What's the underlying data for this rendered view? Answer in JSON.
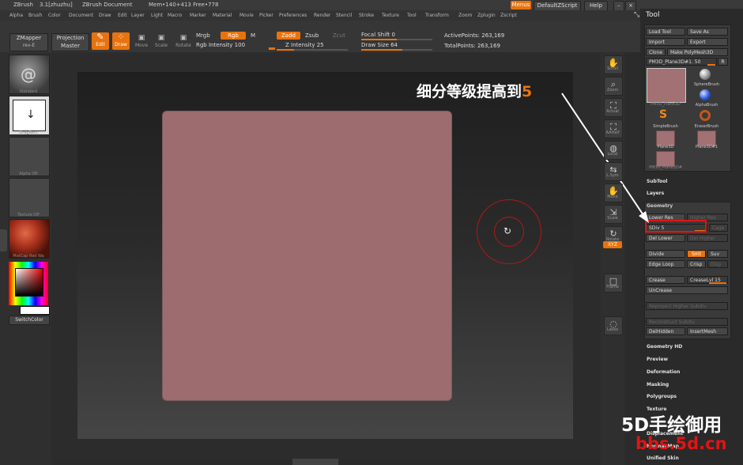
{
  "title_bar": {
    "app": "ZBrush",
    "version": "3.1[zhuzhu]",
    "document": "ZBrush Document",
    "mem": "Mem•140+413 Free•778",
    "menus_btn": "Menus",
    "script_btn": "DefaultZScript",
    "help_btn": "Help"
  },
  "menu_bar": [
    "Alpha",
    "Brush",
    "Color",
    "Document",
    "Draw",
    "Edit",
    "Layer",
    "Light",
    "Macro",
    "Marker",
    "Material",
    "Movie",
    "Picker",
    "Preferences",
    "Render",
    "Stencil",
    "Stroke",
    "Texture",
    "Tool",
    "Transform",
    "Zoom",
    "Zplugin",
    "Zscript"
  ],
  "toolbar": {
    "zmapper": "ZMapper",
    "zmapper_sub": "rev-E",
    "projection": "Projection",
    "master": "Master",
    "edit": "Edit",
    "draw": "Draw",
    "move": "Move",
    "scale": "Scale",
    "rotate": "Rotate",
    "mrgb": "Mrgb",
    "rgb": "Rgb",
    "m": "M",
    "rgb_intensity": "Rgb Intensity 100",
    "zadd": "Zadd",
    "zsub": "Zsub",
    "zcut": "Zcut",
    "z_intensity": "Z Intensity 25",
    "focal_shift": "Focal Shift 0",
    "draw_size": "Draw Size 64",
    "active_points": "ActivePoints: 263,169",
    "total_points": "TotalPoints: 263,169"
  },
  "left_shelf": {
    "brush": "Standard",
    "stroke": "DragRect",
    "alpha": "Alpha Off",
    "texture": "Texture Off",
    "material": "MatCap Red Wa",
    "switch_color": "SwitchColor"
  },
  "right_shelf": [
    "Scroll",
    "Zoom",
    "Actual",
    "AAHalf",
    "Local",
    "L.Sym",
    "Move",
    "Scale",
    "Rotate",
    "XYZ",
    "Frame",
    "Lasso"
  ],
  "tool_panel": {
    "title": "Tool",
    "load_tool": "Load Tool",
    "save_as": "Save As",
    "import": "Import",
    "export": "Export",
    "clone": "Clone",
    "make_polymesh": "Make PolyMesh3D",
    "current_tool": "PM3D_Plane3D#1. 50",
    "r_btn": "R",
    "tools": [
      {
        "label": "PM3D_Plane3D",
        "kind": "plane"
      },
      {
        "label": "SphereBrush",
        "kind": "sphere"
      },
      {
        "label": "AlphaBrush",
        "kind": "alpha"
      },
      {
        "label": "SimpleBrush",
        "kind": "simple"
      },
      {
        "label": "EraserBrush",
        "kind": "eraser"
      },
      {
        "label": "Plane3D",
        "kind": "plane"
      },
      {
        "label": "Plane3D#1",
        "kind": "plane"
      },
      {
        "label": "PM3D_Plane3D#",
        "kind": "plane"
      }
    ],
    "subtool": "SubTool",
    "layers": "Layers",
    "geometry": "Geometry",
    "lower_res": "Lower Res",
    "higher_res": "Higher Res",
    "sdiv": "SDiv 5",
    "cage": "Cage",
    "del_lower": "Del Lower",
    "del_higher": "Del Higher",
    "divide": "Divide",
    "smt": "Smt",
    "suv": "Suv",
    "edge_loop": "Edge Loop",
    "crisp": "Crisp",
    "disp": "Disp",
    "crease": "Crease",
    "crease_lvl": "CreaseLvl 15",
    "uncrease": "UnCrease",
    "reproject": "Reproject Higher Subdiv",
    "reconstruct": "Reconstruct Subdiv",
    "del_hidden": "DelHidden",
    "insert_mesh": "InsertMesh",
    "sections": [
      "Geometry HD",
      "Preview",
      "Deformation",
      "Masking",
      "Polygroups",
      "Texture",
      "Displacement",
      "Normal Map",
      "Unified Skin"
    ]
  },
  "annotation": {
    "text": "细分等级提高到",
    "num": "5"
  },
  "watermark": {
    "line1": "5D手绘御用",
    "line2": "bbs.5d.cn"
  },
  "colors": {
    "accent": "#e8730e",
    "mesh": "#9c6c6f",
    "highlight_box": "#e31313",
    "brush_ring": "#b01818"
  }
}
